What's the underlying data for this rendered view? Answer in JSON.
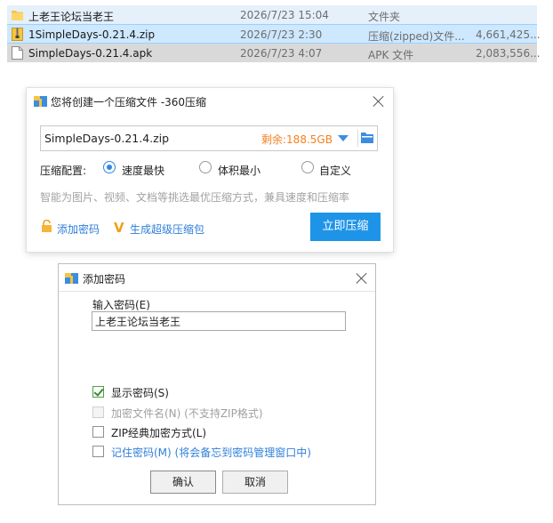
{
  "files": [
    {
      "name": "上老王论坛当老王",
      "date": "2026/7/23 15:04",
      "type": "文件夹",
      "size": "",
      "icon": "folder-icon"
    },
    {
      "name": "1SimpleDays-0.21.4.zip",
      "date": "2026/7/23 2:30",
      "type": "压缩(zipped)文件...",
      "size": "4,661,425...",
      "icon": "zip-file-icon"
    },
    {
      "name": "SimpleDays-0.21.4.apk",
      "date": "2026/7/23 4:07",
      "type": "APK 文件",
      "size": "2,083,556...",
      "icon": "file-icon"
    }
  ],
  "compress_dialog": {
    "title": "您将创建一个压缩文件 -360压缩",
    "path_value": "SimpleDays-0.21.4.zip",
    "free_space": "剩余:188.5GB",
    "config_label": "压缩配置:",
    "options": [
      "速度最快",
      "体积最小",
      "自定义"
    ],
    "selected_option": "速度最快",
    "hint": "智能为图片、视频、文档等挑选最优压缩方式，兼具速度和压缩率",
    "add_password": "添加密码",
    "super_compress": "生成超级压缩包",
    "compress_now": "立即压缩"
  },
  "password_dialog": {
    "title": "添加密码",
    "input_label": "输入密码(E)",
    "input_value": "上老王论坛当老王",
    "checkboxes": {
      "show_password": {
        "label": "显示密码(S)",
        "checked": true
      },
      "encrypt_filename": {
        "label": "加密文件名(N) (不支持ZIP格式)",
        "checked": false,
        "disabled": true
      },
      "zip_classic": {
        "label": "ZIP经典加密方式(L)",
        "checked": false
      },
      "remember": {
        "label": "记住密码(M) (将会备忘到密码管理窗口中)",
        "checked": false
      }
    },
    "ok": "确认",
    "cancel": "取消"
  },
  "colors": {
    "accent": "#1e94e8",
    "link": "#2f7fd8",
    "free_space": "#f5801f"
  }
}
